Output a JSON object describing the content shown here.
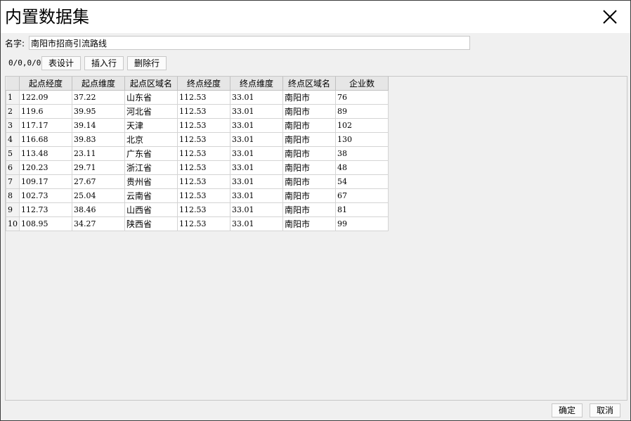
{
  "window": {
    "title": "内置数据集"
  },
  "name_field": {
    "label": "名字:",
    "value": "南阳市招商引流路线"
  },
  "toolbar": {
    "counter": "0/0,0/0",
    "table_design_label": "表设计",
    "insert_row_label": "插入行",
    "delete_row_label": "删除行"
  },
  "table": {
    "columns": [
      "起点经度",
      "起点维度",
      "起点区域名",
      "终点经度",
      "终点维度",
      "终点区域名",
      "企业数"
    ],
    "rows": [
      [
        "1",
        "122.09",
        "37.22",
        "山东省",
        "112.53",
        "33.01",
        "南阳市",
        "76"
      ],
      [
        "2",
        "119.6",
        "39.95",
        "河北省",
        "112.53",
        "33.01",
        "南阳市",
        "89"
      ],
      [
        "3",
        "117.17",
        "39.14",
        "天津",
        "112.53",
        "33.01",
        "南阳市",
        "102"
      ],
      [
        "4",
        "116.68",
        "39.83",
        "北京",
        "112.53",
        "33.01",
        "南阳市",
        "130"
      ],
      [
        "5",
        "113.48",
        "23.11",
        "广东省",
        "112.53",
        "33.01",
        "南阳市",
        "38"
      ],
      [
        "6",
        "120.23",
        "29.71",
        "浙江省",
        "112.53",
        "33.01",
        "南阳市",
        "48"
      ],
      [
        "7",
        "109.17",
        "27.67",
        "贵州省",
        "112.53",
        "33.01",
        "南阳市",
        "54"
      ],
      [
        "8",
        "102.73",
        "25.04",
        "云南省",
        "112.53",
        "33.01",
        "南阳市",
        "67"
      ],
      [
        "9",
        "112.73",
        "38.46",
        "山西省",
        "112.53",
        "33.01",
        "南阳市",
        "81"
      ],
      [
        "10",
        "108.95",
        "34.27",
        "陕西省",
        "112.53",
        "33.01",
        "南阳市",
        "99"
      ]
    ]
  },
  "footer": {
    "ok_label": "确定",
    "cancel_label": "取消"
  }
}
